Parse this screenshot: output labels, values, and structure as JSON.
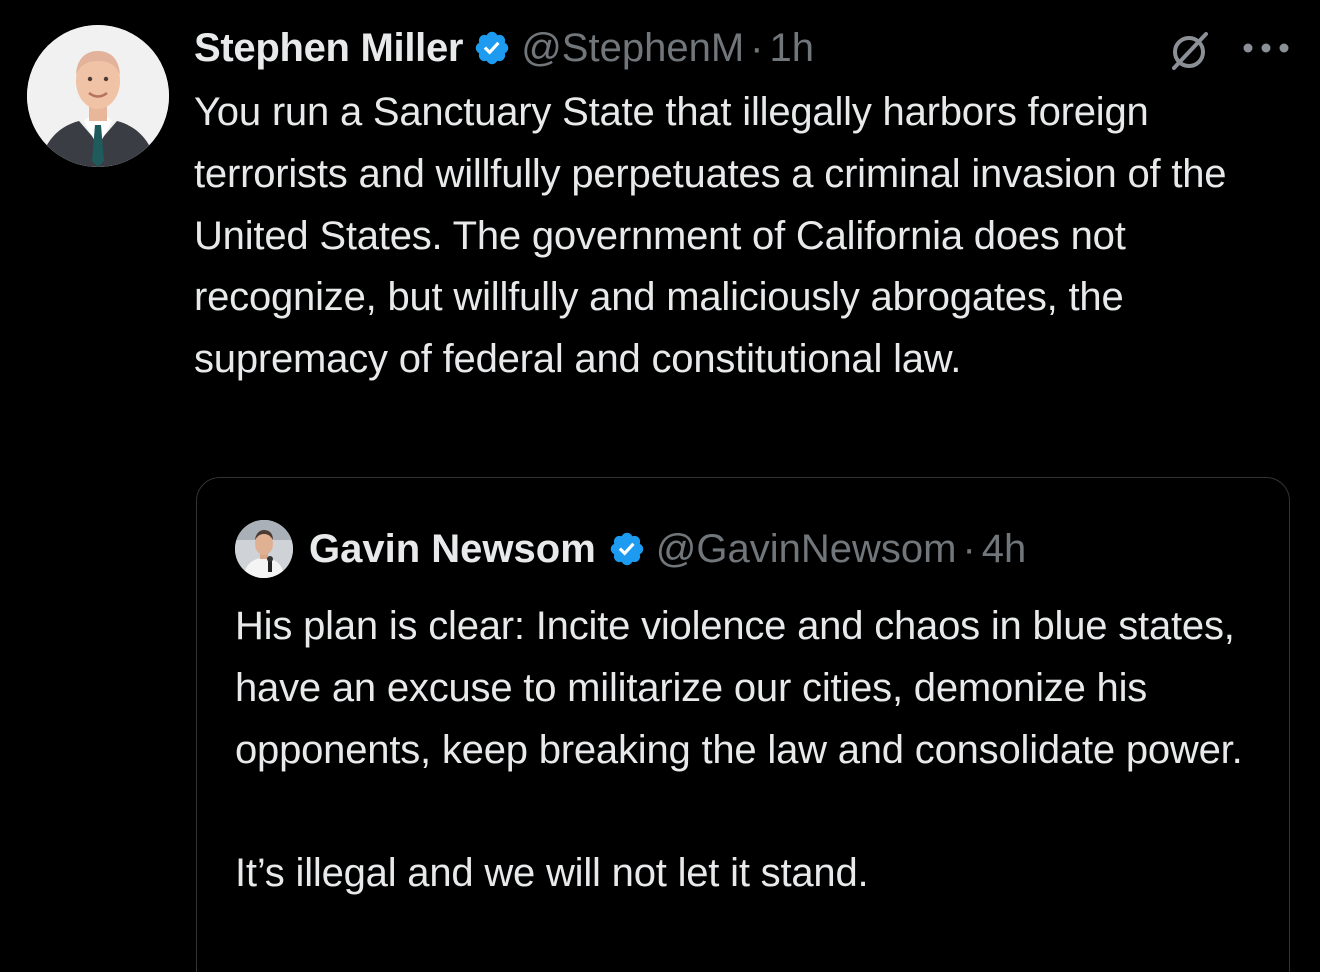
{
  "tweet": {
    "author": {
      "name": "Stephen Miller",
      "handle": "@StephenM",
      "verified": true,
      "avatar": "portrait-man-suit"
    },
    "separator": "·",
    "time": "1h",
    "text": "You run a Sanctuary State that illegally harbors foreign terrorists and willfully perpetuates a criminal invasion of the United States. The government of California does not recognize, but willfully and maliciously abrogates, the supremacy of federal and constitutional law.",
    "icons": {
      "grok": "grok-icon",
      "more": "more-options-icon"
    }
  },
  "quoted_tweet": {
    "author": {
      "name": "Gavin Newsom",
      "handle": "@GavinNewsom",
      "verified": true,
      "avatar": "portrait-man-microphone"
    },
    "separator": "·",
    "time": "4h",
    "paragraphs": [
      "His plan is clear: Incite violence and chaos in blue states, have an excuse to militarize our cities, demonize his opponents, keep breaking the law and consolidate power.",
      "It’s illegal and we will not let it stand."
    ]
  },
  "colors": {
    "background": "#000000",
    "primary_text": "#e7e9ea",
    "secondary_text": "#71767b",
    "verified_blue": "#1d9bf0",
    "border": "#2f3336"
  }
}
